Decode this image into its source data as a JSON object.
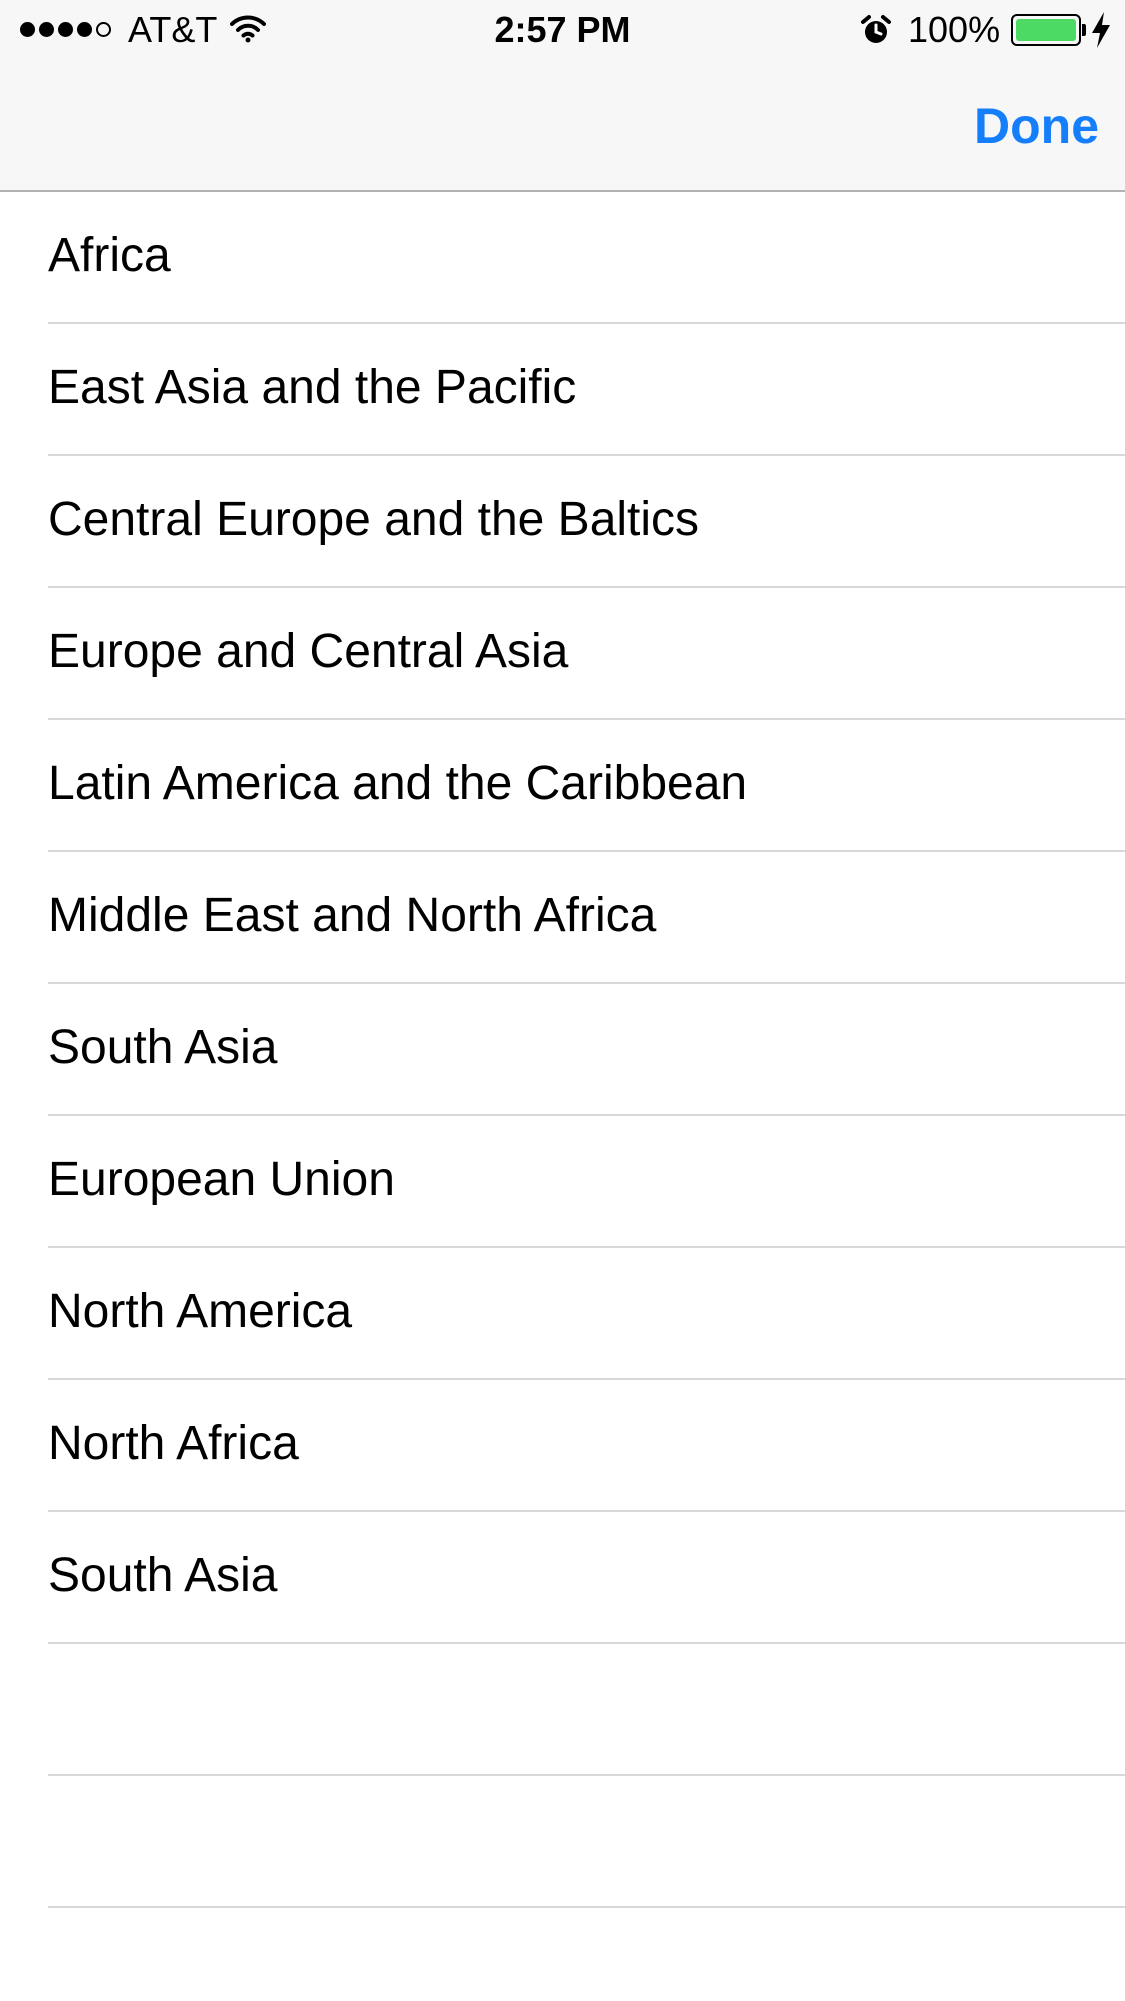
{
  "status_bar": {
    "carrier": "AT&T",
    "time": "2:57 PM",
    "battery_percent": "100%",
    "battery_level": 1.0,
    "battery_color": "#4cd964",
    "signal_bars_filled": 4,
    "signal_bars_total": 5,
    "icons": [
      "signal-dots-icon",
      "wifi-icon",
      "alarm-icon",
      "battery-icon",
      "charging-bolt-icon"
    ]
  },
  "nav_bar": {
    "done_label": "Done",
    "accent_color": "#157efb"
  },
  "list": {
    "items": [
      {
        "label": "Africa"
      },
      {
        "label": "East Asia and the Pacific"
      },
      {
        "label": "Central Europe and the Baltics"
      },
      {
        "label": "Europe and Central Asia"
      },
      {
        "label": "Latin America and the Caribbean"
      },
      {
        "label": "Middle East and North Africa"
      },
      {
        "label": "South Asia"
      },
      {
        "label": "European Union"
      },
      {
        "label": "North America"
      },
      {
        "label": "North Africa"
      },
      {
        "label": "South Asia"
      },
      {
        "label": ""
      },
      {
        "label": ""
      }
    ]
  }
}
